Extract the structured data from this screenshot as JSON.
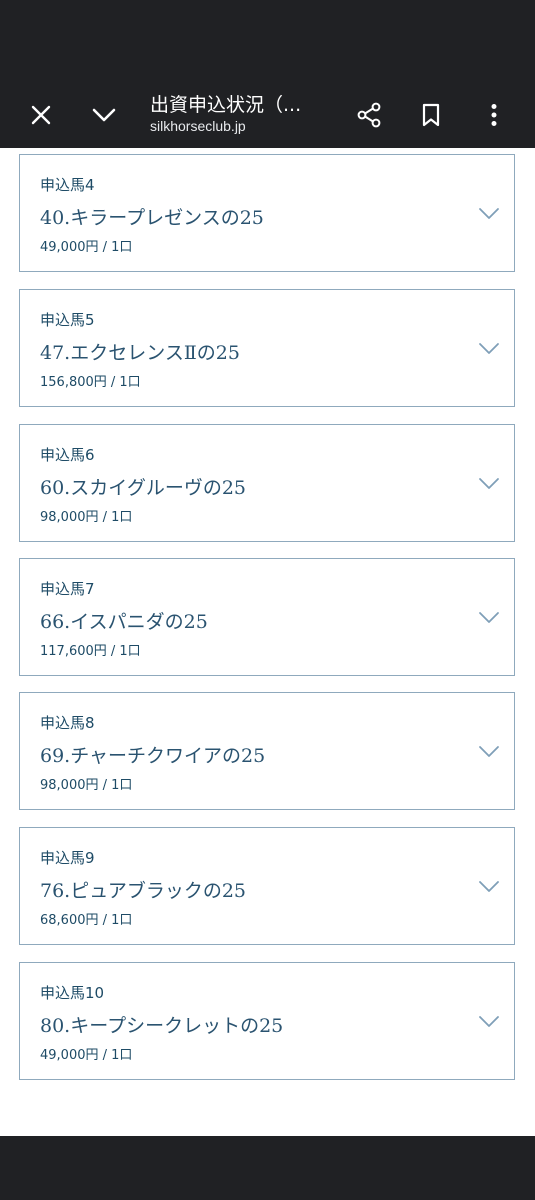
{
  "toolbar": {
    "title": "出資申込状況（...",
    "url": "silkhorseclub.jp"
  },
  "icons": {
    "close": "close-icon",
    "collapse": "chevron-down-icon",
    "share": "share-icon",
    "bookmark": "bookmark-icon",
    "menu": "more-vert-icon",
    "card_expand": "chevron-down-icon"
  },
  "colors": {
    "toolbar_bg": "#202124",
    "card_border": "#8fa9bd",
    "text_navy": "#1e4b66",
    "chevron": "#7f9fb8"
  },
  "cards": [
    {
      "label": "申込馬4",
      "name": "40.キラープレゼンスの25",
      "price": "49,000円 / 1口"
    },
    {
      "label": "申込馬5",
      "name": "47.エクセレンスⅡの25",
      "price": "156,800円 / 1口"
    },
    {
      "label": "申込馬6",
      "name": "60.スカイグルーヴの25",
      "price": "98,000円 / 1口"
    },
    {
      "label": "申込馬7",
      "name": "66.イスパニダの25",
      "price": "117,600円 / 1口"
    },
    {
      "label": "申込馬8",
      "name": "69.チャーチクワイアの25",
      "price": "98,000円 / 1口"
    },
    {
      "label": "申込馬9",
      "name": "76.ピュアブラックの25",
      "price": "68,600円 / 1口"
    },
    {
      "label": "申込馬10",
      "name": "80.キープシークレットの25",
      "price": "49,000円 / 1口"
    }
  ]
}
